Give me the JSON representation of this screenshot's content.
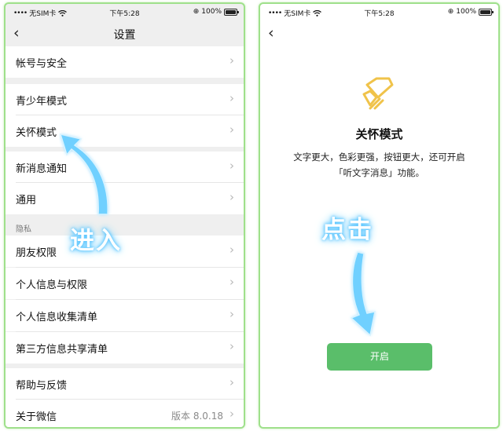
{
  "status": {
    "carrier": "无SIM卡",
    "time": "下午5:28",
    "battery": "100%",
    "lock_glyph": "⊕"
  },
  "left": {
    "title": "设置",
    "sections": [
      {
        "items": [
          {
            "label": "帐号与安全"
          }
        ]
      },
      {
        "items": [
          {
            "label": "青少年模式"
          },
          {
            "label": "关怀模式"
          }
        ]
      },
      {
        "items": [
          {
            "label": "新消息通知"
          },
          {
            "label": "通用"
          }
        ]
      },
      {
        "header": "隐私",
        "items": [
          {
            "label": "朋友权限"
          },
          {
            "label": "个人信息与权限"
          },
          {
            "label": "个人信息收集清单"
          },
          {
            "label": "第三方信息共享清单"
          }
        ]
      },
      {
        "items": [
          {
            "label": "帮助与反馈"
          },
          {
            "label": "关于微信",
            "value": "版本 8.0.18"
          }
        ]
      }
    ],
    "overlay": "进入"
  },
  "right": {
    "title": "关怀模式",
    "desc_line1": "文字更大，色彩更强，按钮更大，还可开启",
    "desc_line2": "「听文字消息」功能。",
    "button": "开启",
    "overlay": "点击"
  },
  "colors": {
    "accent_green": "#5abe6a",
    "icon_yellow": "#f0c34a",
    "frame_green": "#9fe08b",
    "arrow_blue": "#6fd0ff"
  },
  "icons": {
    "back": "back-chevron-icon",
    "chevron": "chevron-right-icon",
    "care": "care-mode-heart-hand-icon"
  }
}
